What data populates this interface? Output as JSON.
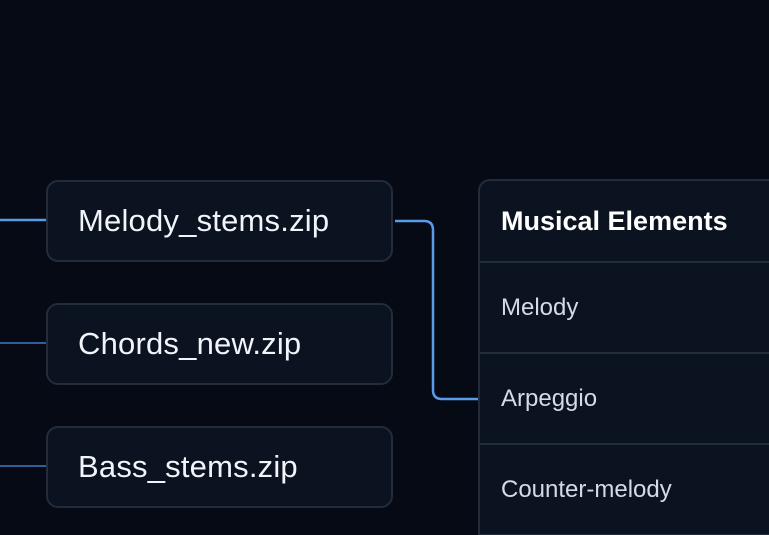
{
  "files": [
    {
      "name": "Melody_stems.zip"
    },
    {
      "name": "Chords_new.zip"
    },
    {
      "name": "Bass_stems.zip"
    }
  ],
  "panel": {
    "title": "Musical Elements",
    "items": [
      "Melody",
      "Arpeggio",
      "Counter-melody"
    ]
  },
  "colors": {
    "background": "#050a14",
    "node_fill": "#0b1220",
    "node_border": "#232c3b",
    "active_connector": "#5b9ae6",
    "inactive_connector": "#2f5f96"
  }
}
